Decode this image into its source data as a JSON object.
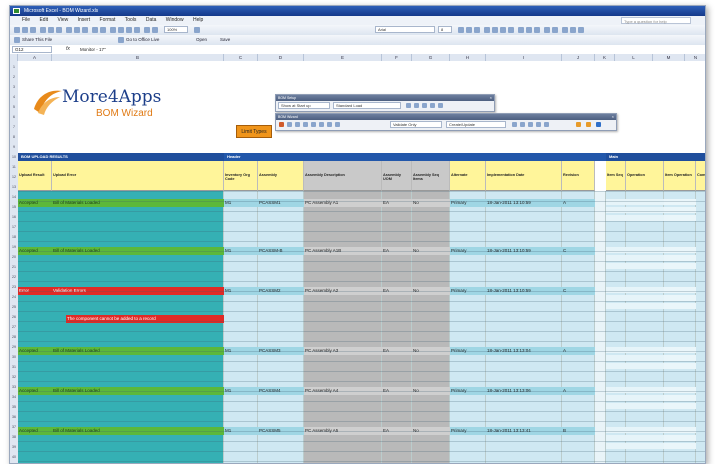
{
  "window": {
    "title": "Microsoft Excel - BOM Wizard.xls"
  },
  "menu": [
    "File",
    "Edit",
    "View",
    "Insert",
    "Format",
    "Tools",
    "Data",
    "Window",
    "Help"
  ],
  "help_placeholder": "Type a question for help",
  "toolbar": {
    "zoom": "100%",
    "font": "Arial",
    "font_size": "8",
    "share": "Share This File",
    "go_office_live": "Go to Office Live",
    "open": "Open",
    "save": "Save"
  },
  "formula": {
    "cell": "G12",
    "value": "Monitor - 17\""
  },
  "columns": [
    "A",
    "B",
    "C",
    "D",
    "E",
    "F",
    "G",
    "H",
    "I",
    "J",
    "K",
    "L",
    "M",
    "N",
    "O"
  ],
  "logo": {
    "main": "More4Apps",
    "sub": "BOM Wizard"
  },
  "limit_button": "Limit Types",
  "bom_setup": {
    "title": "BOM Setup",
    "option1": "Show at Start up",
    "option2": "Standard Load"
  },
  "bom_wizard": {
    "title": "BOM Wizard",
    "option1": "Validate Only",
    "option2": "Create/Update"
  },
  "bands": {
    "left": "BOM UPLOAD RESULTS",
    "header": "Header",
    "main": "Main"
  },
  "headers": {
    "upload_result": "Upload Result",
    "upload_error": "Upload Error",
    "inv_org": "Inventory Org Code",
    "assembly": "Assembly",
    "assembly_desc": "Assembly Description",
    "assembly_uom": "Assembly UOM",
    "assembly_seq": "Assembly Seq Items",
    "alternate": "Alternate",
    "impl_date": "Implementation Date",
    "revision": "Revision",
    "item_seq": "Item Seq",
    "operation": "Operation",
    "item_op": "Item Operation",
    "comp": "Com"
  },
  "records": [
    {
      "result": "Accepted",
      "error": "Bill of Materials Loaded",
      "org": "M1",
      "assembly": "PCASSM1",
      "desc": "PC Assembly A1",
      "uom": "EA",
      "seq": "No",
      "alt": "Primary",
      "date": "18-Jan-2011 13:10:59",
      "rev": "A",
      "status": "ok"
    },
    {
      "result": "Accepted",
      "error": "Bill of Materials Loaded",
      "org": "M1",
      "assembly": "PCASSM-B",
      "desc": "PC Assembly A1B",
      "uom": "EA",
      "seq": "No",
      "alt": "Primary",
      "date": "18-Jan-2011 13:10:59",
      "rev": "C",
      "status": "ok"
    },
    {
      "result": "Error",
      "error": "Validation Errors",
      "org": "M1",
      "assembly": "PCASSM2",
      "desc": "PC Assembly A2",
      "uom": "EA",
      "seq": "No",
      "alt": "Primary",
      "date": "18-Jan-2011 13:10:59",
      "rev": "C",
      "status": "error",
      "sub_error": "The component cannot be added to a record"
    },
    {
      "result": "Accepted",
      "error": "Bill of Materials Loaded",
      "org": "M1",
      "assembly": "PCASSM3",
      "desc": "PC Assembly A3",
      "uom": "EA",
      "seq": "No",
      "alt": "Primary",
      "date": "18-Jan-2011 13:13:04",
      "rev": "A",
      "status": "ok"
    },
    {
      "result": "Accepted",
      "error": "Bill of Materials Loaded",
      "org": "M1",
      "assembly": "PCASSM4",
      "desc": "PC Assembly A4",
      "uom": "EA",
      "seq": "No",
      "alt": "Primary",
      "date": "18-Jan-2011 13:13:06",
      "rev": "A",
      "status": "ok"
    },
    {
      "result": "Accepted",
      "error": "Bill of Materials Loaded",
      "org": "M1",
      "assembly": "PCASSM5",
      "desc": "PC Assembly A5",
      "uom": "EA",
      "seq": "No",
      "alt": "Primary",
      "date": "18-Jan-2011 13:13:41",
      "rev": "B",
      "status": "ok"
    }
  ],
  "colors": {
    "green": "#5cb83a",
    "teal": "#35b0b4",
    "red": "#e02a26",
    "yellow": "#fff59a",
    "navy": "#1f4e9c",
    "lightblue": "#cfe8f2",
    "orange": "#f0951b"
  }
}
